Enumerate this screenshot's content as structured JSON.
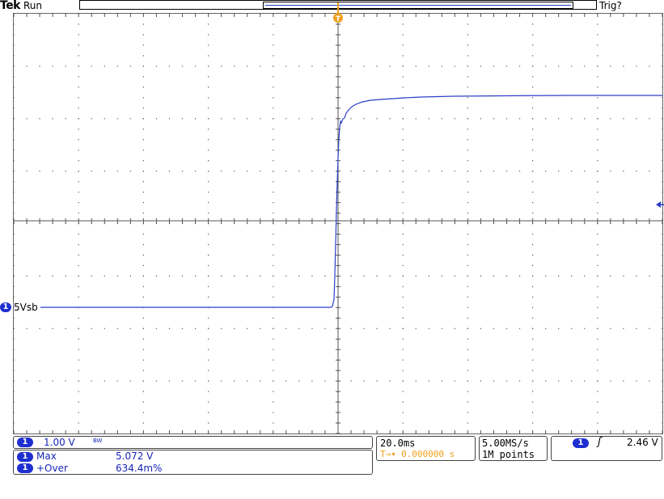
{
  "header": {
    "brand": "Tek",
    "run_state": "Run",
    "trigger_state": "Trig?"
  },
  "trigger_marker": {
    "label": "T"
  },
  "channel": {
    "number": "1",
    "label": "5Vsb",
    "scale": "1.00 V",
    "bandwidth_symbol": "BW",
    "color": "#2c3fc7"
  },
  "measurements": [
    {
      "badge": "1",
      "name": "Max",
      "value": "5.072 V"
    },
    {
      "badge": "1",
      "name": "+Over",
      "value": "634.4m%"
    }
  ],
  "timebase": {
    "scale": "20.0ms",
    "trigger_position": "0.000000 s",
    "sample_rate": "5.00MS/s",
    "record_length": "1M points"
  },
  "trigger": {
    "source_badge": "1",
    "slope_symbol": "ʃ",
    "level": "2.46 V"
  },
  "colors": {
    "trace": "#2c3fc7",
    "accent_orange": "#f0a020",
    "grid": "#555555"
  }
}
